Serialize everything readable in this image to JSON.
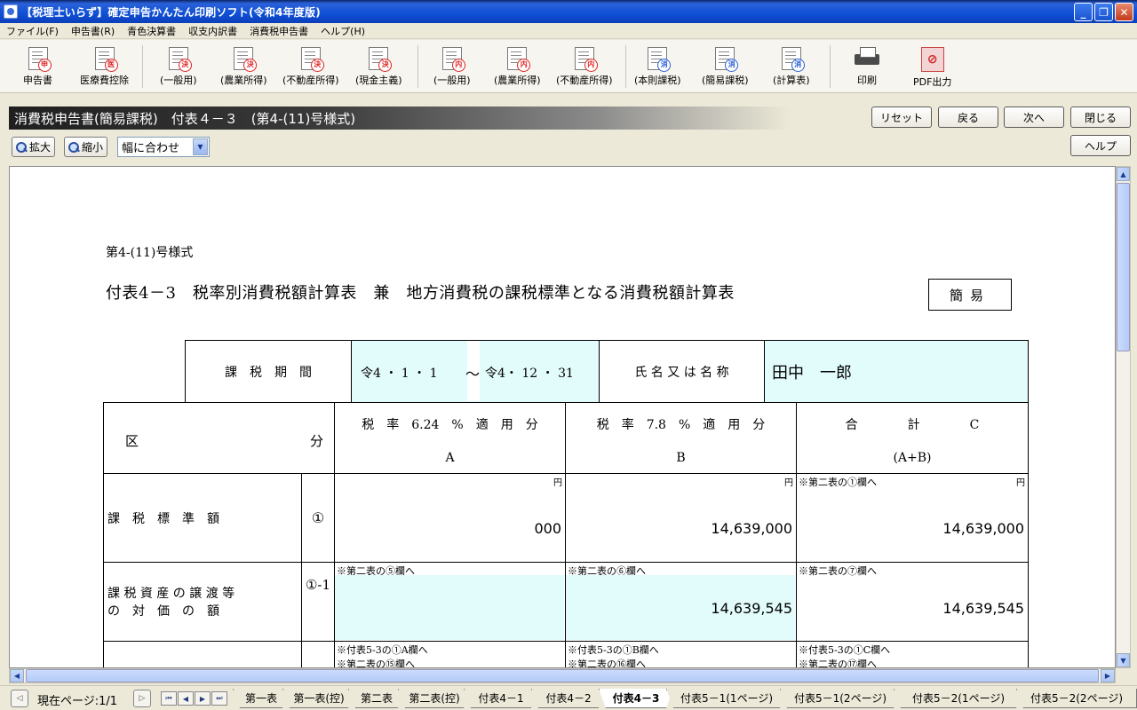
{
  "window": {
    "title": "【税理士いらず】確定申告かんたん印刷ソフト(令和4年度版)"
  },
  "menu": [
    "ファイル(F)",
    "申告書(R)",
    "青色決算書",
    "収支内訳書",
    "消費税申告書",
    "ヘルプ(H)"
  ],
  "toolbar": [
    {
      "label": "申告書",
      "icon": "tax-return-icon",
      "stamp": "申"
    },
    {
      "label": "医療費控除",
      "icon": "medical-deduction-icon",
      "stamp": "医"
    },
    {
      "label": "(一般用)",
      "icon": "settlement-general-icon",
      "stamp": "決"
    },
    {
      "label": "(農業所得)",
      "icon": "settlement-agri-icon",
      "stamp": "決"
    },
    {
      "label": "(不動産所得)",
      "icon": "settlement-realestate-icon",
      "stamp": "決"
    },
    {
      "label": "(現金主義)",
      "icon": "settlement-cash-icon",
      "stamp": "決"
    },
    {
      "label": "(一般用)",
      "icon": "breakdown-general-icon",
      "stamp": "内"
    },
    {
      "label": "(農業所得)",
      "icon": "breakdown-agri-icon",
      "stamp": "内"
    },
    {
      "label": "(不動産所得)",
      "icon": "breakdown-realestate-icon",
      "stamp": "内"
    },
    {
      "label": "(本則課税)",
      "icon": "consumption-standard-icon",
      "stamp": "消"
    },
    {
      "label": "(簡易課税)",
      "icon": "consumption-simplified-icon",
      "stamp": "消"
    },
    {
      "label": "(計算表)",
      "icon": "consumption-calc-icon",
      "stamp": "消"
    },
    {
      "label": "印刷",
      "icon": "printer-icon"
    },
    {
      "label": "PDF出力",
      "icon": "pdf-icon"
    }
  ],
  "header": {
    "title": "消費税申告書(簡易課税)　付表４－３　(第4-(11)号様式)"
  },
  "nav": {
    "reset": "リセット",
    "back": "戻る",
    "next": "次へ",
    "close": "閉じる",
    "help": "ヘルプ"
  },
  "zoom": {
    "in": "拡大",
    "out": "縮小",
    "fit": "幅に合わせ"
  },
  "form": {
    "form_no": "第4-(11)号様式",
    "title": "付表4－3　税率別消費税額計算表　兼　地方消費税の課税標準となる消費税額計算表",
    "kan": "簡易",
    "period_label": "課　税　期　間",
    "period_from": "令4 ・ 1 ・ 1",
    "period_sep": "～",
    "period_to": "令4・ 12 ・ 31",
    "name_label": "氏 名 又 は 名 称",
    "name_value": "田中　一郎",
    "kubun": "区",
    "bun": "分",
    "colA_title": "税　率　6.24　%　適　用　分",
    "colA_sub": "A",
    "colB_title": "税　率　7.8　%　適　用　分",
    "colB_sub": "B",
    "colC_title": "合　　　　計　　　　C",
    "colC_sub": "(A+B)",
    "yen": "円",
    "row1": {
      "label": "課　税　標　準　額",
      "num": "①",
      "a": "000",
      "b": "14,639,000",
      "c_note": "※第二表の①欄へ",
      "c": "14,639,000"
    },
    "row2": {
      "label1": "課 税 資 産 の 譲 渡 等",
      "label2": "の　対　価　の　額",
      "num": "①-1",
      "a_note": "※第二表の⑤欄へ",
      "b_note": "※第二表の⑥欄へ",
      "b": "14,639,545",
      "c_note": "※第二表の⑦欄へ",
      "c": "14,639,545"
    },
    "row3": {
      "a_note1": "※付表5-3の①A欄へ",
      "a_note2": "※第二表の⑮欄へ",
      "b_note1": "※付表5-3の①B欄へ",
      "b_note2": "※第二表の⑯欄へ",
      "c_note1": "※付表5-3の①C欄へ",
      "c_note2": "※第二表の⑰欄へ"
    }
  },
  "status": {
    "page": "現在ページ:1/1"
  },
  "tabs": [
    "第一表",
    "第一表(控)",
    "第二表",
    "第二表(控)",
    "付表4－1",
    "付表4－2",
    "付表4－3",
    "付表5－1(1ページ)",
    "付表5－1(2ページ)",
    "付表5－2(1ページ)",
    "付表5－2(2ページ)"
  ],
  "active_tab": "付表4－3"
}
